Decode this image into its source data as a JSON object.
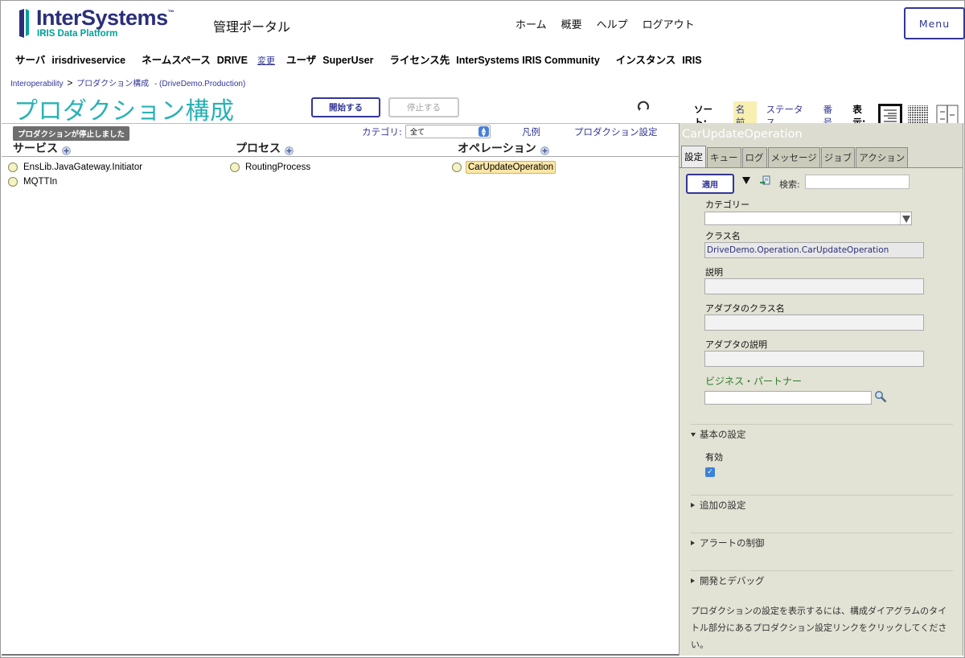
{
  "header": {
    "logo_name": "InterSystems",
    "logo_tm": "™",
    "logo_sub": "IRIS Data Platform",
    "portal_title": "管理ポータル",
    "nav": [
      "ホーム",
      "概要",
      "ヘルプ",
      "ログアウト"
    ],
    "menu_label": "Menu"
  },
  "info": {
    "server_label": "サーバ",
    "server_value": "irisdriveservice",
    "namespace_label": "ネームスペース",
    "namespace_value": "DRIVE",
    "change_link": "変更",
    "user_label": "ユーザ",
    "user_value": "SuperUser",
    "license_label": "ライセンス先",
    "license_value": "InterSystems IRIS Community",
    "instance_label": "インスタンス",
    "instance_value": "IRIS"
  },
  "breadcrumb": {
    "item1": "Interoperability",
    "sep": ">",
    "item2": "プロダクション構成",
    "item3": "- (DriveDemo.Production)"
  },
  "page": {
    "title": "プロダクション構成",
    "start_button": "開始する",
    "stop_button": "停止する"
  },
  "sortbar": {
    "sort_label": "ソート:",
    "options": [
      "名前",
      "ステータス",
      "番号"
    ],
    "selected": "名前",
    "display_label": "表示:"
  },
  "diagram": {
    "status_badge": "プロダクションが停止しました",
    "category_label": "カテゴリ:",
    "category_value": "全て",
    "legend_link": "凡例",
    "settings_link": "プロダクション設定",
    "columns": {
      "services": "サービス",
      "processes": "プロセス",
      "operations": "オペレーション"
    },
    "services": [
      "EnsLib.JavaGateway.Initiator",
      "MQTTIn"
    ],
    "processes": [
      "RoutingProcess"
    ],
    "operations": [
      "CarUpdateOperation"
    ],
    "selected_item": "CarUpdateOperation"
  },
  "panel": {
    "title": "CarUpdateOperation",
    "tabs": [
      "設定",
      "キュー",
      "ログ",
      "メッセージ",
      "ジョブ",
      "アクション"
    ],
    "apply_button": "適用",
    "search_label": "検索:",
    "search_value": "",
    "category_label": "カテゴリー",
    "category_value": "",
    "class_label": "クラス名",
    "class_value": "DriveDemo.Operation.CarUpdateOperation",
    "desc_label": "説明",
    "desc_value": "",
    "adapter_class_label": "アダプタのクラス名",
    "adapter_class_value": "",
    "adapter_desc_label": "アダプタの説明",
    "adapter_desc_value": "",
    "partner_label": "ビジネス・パートナー",
    "partner_value": "",
    "sections": {
      "basic": "基本の設定",
      "additional": "追加の設定",
      "alert": "アラートの制御",
      "dev": "開発とデバッグ"
    },
    "enabled_label": "有効",
    "enabled_checked": true,
    "help_text": "プロダクションの設定を表示するには、構成ダイアグラムのタイトル部分にあるプロダクション設定リンクをクリックしてください。"
  },
  "colors": {
    "brand_navy": "#333695",
    "brand_teal": "#00a09a",
    "title_teal": "#2ab1b5",
    "panel_bg": "#dcdcd0",
    "panel_header": "#6e6e6e",
    "selected_item_bg": "#fbe7a7"
  }
}
